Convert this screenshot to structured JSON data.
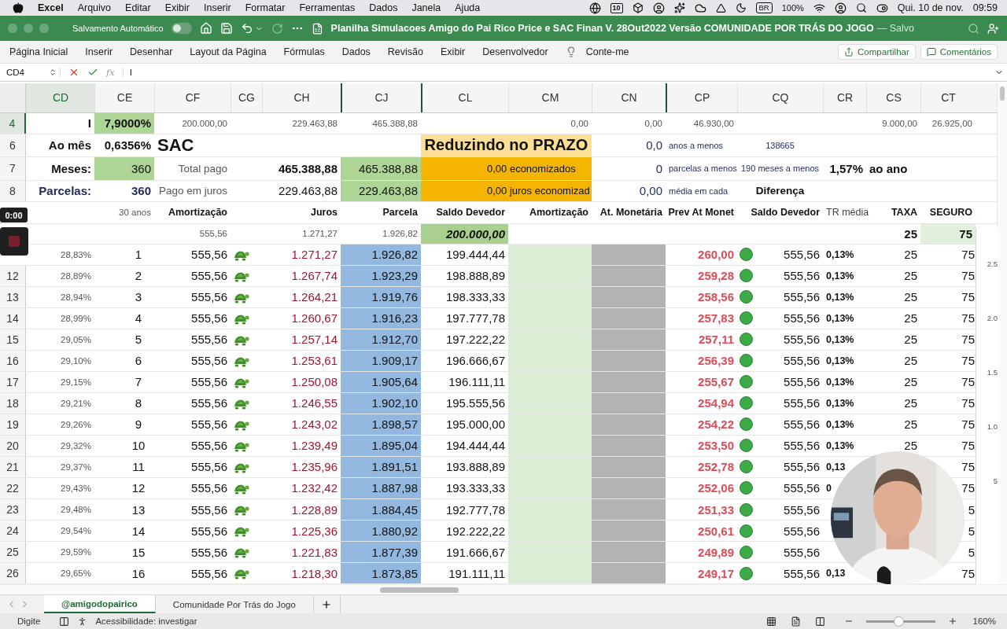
{
  "menu_bar": {
    "app": "Excel",
    "menus": [
      "Arquivo",
      "Editar",
      "Exibir",
      "Inserir",
      "Formatar",
      "Ferramentas",
      "Dados",
      "Janela",
      "Ajuda"
    ],
    "calendar_day": "10",
    "keyboard": "BR",
    "battery": "100%",
    "date": "Qui. 10 de nov.",
    "time": "09:59"
  },
  "title_bar": {
    "autosave_label": "Salvamento Automático",
    "autosave_on": false,
    "title": "Planilha Simulacoes Amigo do Pai Rico Price e SAC Finan V. 28Out2022 Versão COMUNIDADE POR TRÁS DO JOGO",
    "status": "— Salvo"
  },
  "ribbon": {
    "tabs": [
      "Página Inicial",
      "Inserir",
      "Desenhar",
      "Layout da Página",
      "Fórmulas",
      "Dados",
      "Revisão",
      "Exibir",
      "Desenvolvedor"
    ],
    "tell_me": "Conte-me",
    "share": "Compartilhar",
    "comments": "Comentários"
  },
  "formula_bar": {
    "cell": "CD4",
    "function_label": "fx",
    "value": "I"
  },
  "sheet": {
    "columns": [
      {
        "label": "CD",
        "selected": true
      },
      {
        "label": "CE",
        "selected": false
      },
      {
        "label": "CF",
        "selected": false
      },
      {
        "label": "CG",
        "selected": false
      },
      {
        "label": "CH",
        "selected": false
      },
      {
        "label": "CJ",
        "selected": false
      },
      {
        "label": "CL",
        "selected": false
      },
      {
        "label": "CM",
        "selected": false
      },
      {
        "label": "CN",
        "selected": false
      },
      {
        "label": "CP",
        "selected": false
      },
      {
        "label": "CQ",
        "selected": false
      },
      {
        "label": "CR",
        "selected": false
      },
      {
        "label": "CS",
        "selected": false
      },
      {
        "label": "CT",
        "selected": false
      }
    ],
    "top_rows": [
      {
        "number": "4",
        "selected": true,
        "cells": [
          {
            "kind": "label",
            "text": "I"
          },
          {
            "kind": "input-bold",
            "text": "7,9000%"
          },
          {
            "kind": "small",
            "text": "200.000,00"
          },
          {
            "kind": "empty"
          },
          {
            "kind": "small",
            "text": "229.463,88"
          },
          {
            "kind": "small",
            "text": "465.388,88"
          },
          {
            "kind": "empty"
          },
          {
            "kind": "small",
            "text": "0,00"
          },
          {
            "kind": "small",
            "text": "0,00"
          },
          {
            "kind": "small",
            "text": "46.930,00"
          },
          {
            "kind": "empty"
          },
          {
            "kind": "empty"
          },
          {
            "kind": "small",
            "text": "9.000,00"
          },
          {
            "kind": "small",
            "text": "26.925,00"
          }
        ]
      },
      {
        "number": "6",
        "selected": false,
        "cells": [
          {
            "kind": "label",
            "text": "Ao mês"
          },
          {
            "kind": "strong",
            "text": "0,6356%"
          },
          {
            "kind": "title",
            "text": "SAC"
          },
          {
            "kind": "empty"
          },
          {
            "kind": "empty"
          },
          {
            "kind": "banner",
            "text": "Reduzindo no PRAZO"
          },
          {
            "kind": "navy-number",
            "text": "0,0"
          },
          {
            "kind": "navy-small",
            "text": "anos a menos"
          },
          {
            "kind": "navy-small-center",
            "text": "138665"
          },
          {
            "kind": "empty"
          },
          {
            "kind": "empty"
          },
          {
            "kind": "empty"
          }
        ]
      },
      {
        "number": "7",
        "selected": false,
        "cells": [
          {
            "kind": "label",
            "text": "Meses:"
          },
          {
            "kind": "input",
            "text": "360"
          },
          {
            "kind": "caption",
            "text": "Total pago"
          },
          {
            "kind": "empty"
          },
          {
            "kind": "strong",
            "text": "465.388,88"
          },
          {
            "kind": "green-number",
            "text": "465.388,88"
          },
          {
            "kind": "orange",
            "text": "0,00 economizados"
          },
          {
            "kind": "navy-number",
            "text": "0"
          },
          {
            "kind": "navy-small",
            "text": "parcelas a menos"
          },
          {
            "kind": "navy-small-center",
            "text": "190 meses a menos"
          },
          {
            "kind": "strong",
            "text": "1,57%"
          },
          {
            "kind": "strong-left",
            "text": "ao ano"
          },
          {
            "kind": "empty"
          }
        ]
      },
      {
        "number": "8",
        "selected": false,
        "cells": [
          {
            "kind": "label-navy",
            "text": "Parcelas:"
          },
          {
            "kind": "value-navy",
            "text": "360"
          },
          {
            "kind": "caption",
            "text": "Pago em juros"
          },
          {
            "kind": "empty"
          },
          {
            "kind": "number",
            "text": "229.463,88"
          },
          {
            "kind": "green-number",
            "text": "229.463,88"
          },
          {
            "kind": "orange",
            "text": "0,00 juros economizad"
          },
          {
            "kind": "navy-number",
            "text": "0,00"
          },
          {
            "kind": "navy-small",
            "text": "média em cada"
          },
          {
            "kind": "strong-center",
            "text": "Diferença"
          },
          {
            "kind": "empty"
          },
          {
            "kind": "empty"
          },
          {
            "kind": "empty"
          }
        ]
      },
      {
        "selected": false,
        "cells": [
          {
            "kind": "empty"
          },
          {
            "kind": "small",
            "text": "30 anos"
          },
          {
            "kind": "header",
            "text": "Amortização"
          },
          {
            "kind": "empty"
          },
          {
            "kind": "header",
            "text": "Juros"
          },
          {
            "kind": "header",
            "text": "Parcela"
          },
          {
            "kind": "header",
            "text": "Saldo Devedor"
          },
          {
            "kind": "header",
            "text": "Amortização"
          },
          {
            "kind": "header",
            "text": "At. Monetária"
          },
          {
            "kind": "header",
            "text": "Prev At Monet"
          },
          {
            "kind": "header",
            "text": "Saldo Devedor"
          },
          {
            "kind": "header-plain",
            "text": "TR média"
          },
          {
            "kind": "header",
            "text": "TAXA"
          },
          {
            "kind": "header",
            "text": "SEGURO"
          }
        ]
      },
      {
        "selected": false,
        "cells": [
          {
            "kind": "empty"
          },
          {
            "kind": "empty"
          },
          {
            "kind": "small",
            "text": "555,56"
          },
          {
            "kind": "empty"
          },
          {
            "kind": "small",
            "text": "1.271,27"
          },
          {
            "kind": "small",
            "text": "1.926,82"
          },
          {
            "kind": "initial",
            "text": "200.000,00"
          },
          {
            "kind": "empty"
          },
          {
            "kind": "empty"
          },
          {
            "kind": "empty"
          },
          {
            "kind": "empty"
          },
          {
            "kind": "empty"
          },
          {
            "kind": "strong",
            "text": "25"
          },
          {
            "kind": "strong-tint",
            "text": "75"
          }
        ]
      }
    ],
    "data_rows": [
      {
        "pct": "28,83%",
        "n": "1",
        "amort": "555,56",
        "juros": "1.271,27",
        "parcela": "1.926,82",
        "saldo": "199.444,44",
        "prev": "260,00",
        "color": "#3daa48",
        "saldo2": "555,56",
        "tr": "0,13%",
        "taxa": "25",
        "seguro": "75"
      },
      {
        "number": "12",
        "pct": "28,89%",
        "n": "2",
        "amort": "555,56",
        "juros": "1.267,74",
        "parcela": "1.923,29",
        "saldo": "198.888,89",
        "prev": "259,28",
        "color": "#3daa48",
        "saldo2": "555,56",
        "tr": "0,13%",
        "taxa": "25",
        "seguro": "75"
      },
      {
        "number": "13",
        "pct": "28,94%",
        "n": "3",
        "amort": "555,56",
        "juros": "1.264,21",
        "parcela": "1.919,76",
        "saldo": "198.333,33",
        "prev": "258,56",
        "color": "#3daa48",
        "saldo2": "555,56",
        "tr": "0,13%",
        "taxa": "25",
        "seguro": "75"
      },
      {
        "number": "14",
        "pct": "28,99%",
        "n": "4",
        "amort": "555,56",
        "juros": "1.260,67",
        "parcela": "1.916,23",
        "saldo": "197.777,78",
        "prev": "257,83",
        "color": "#3daa48",
        "saldo2": "555,56",
        "tr": "0,13%",
        "taxa": "25",
        "seguro": "75"
      },
      {
        "number": "15",
        "pct": "29,05%",
        "n": "5",
        "amort": "555,56",
        "juros": "1.257,14",
        "parcela": "1.912,70",
        "saldo": "197.222,22",
        "prev": "257,11",
        "color": "#3daa48",
        "saldo2": "555,56",
        "tr": "0,13%",
        "taxa": "25",
        "seguro": "75"
      },
      {
        "number": "16",
        "pct": "29,10%",
        "n": "6",
        "amort": "555,56",
        "juros": "1.253,61",
        "parcela": "1.909,17",
        "saldo": "196.666,67",
        "prev": "256,39",
        "color": "#3daa48",
        "saldo2": "555,56",
        "tr": "0,13%",
        "taxa": "25",
        "seguro": "75"
      },
      {
        "number": "17",
        "pct": "29,15%",
        "n": "7",
        "amort": "555,56",
        "juros": "1.250,08",
        "parcela": "1.905,64",
        "saldo": "196.111,11",
        "prev": "255,67",
        "color": "#3daa48",
        "saldo2": "555,56",
        "tr": "0,13%",
        "taxa": "25",
        "seguro": "75"
      },
      {
        "number": "18",
        "pct": "29,21%",
        "n": "8",
        "amort": "555,56",
        "juros": "1.246,55",
        "parcela": "1.902,10",
        "saldo": "195.555,56",
        "prev": "254,94",
        "color": "#3daa48",
        "saldo2": "555,56",
        "tr": "0,13%",
        "taxa": "25",
        "seguro": "75"
      },
      {
        "number": "19",
        "pct": "29,26%",
        "n": "9",
        "amort": "555,56",
        "juros": "1.243,02",
        "parcela": "1.898,57",
        "saldo": "195.000,00",
        "prev": "254,22",
        "color": "#3daa48",
        "saldo2": "555,56",
        "tr": "0,13%",
        "taxa": "25",
        "seguro": "75"
      },
      {
        "number": "20",
        "pct": "29,32%",
        "n": "10",
        "amort": "555,56",
        "juros": "1.239,49",
        "parcela": "1.895,04",
        "saldo": "194.444,44",
        "prev": "253,50",
        "color": "#3daa48",
        "saldo2": "555,56",
        "tr": "0,13%",
        "taxa": "25",
        "seguro": "75"
      },
      {
        "number": "21",
        "pct": "29,37%",
        "n": "11",
        "amort": "555,56",
        "juros": "1.235,96",
        "parcela": "1.891,51",
        "saldo": "193.888,89",
        "prev": "252,78",
        "color": "#3daa48",
        "saldo2": "555,56",
        "tr": "0,13",
        "seguro": "75"
      },
      {
        "number": "22",
        "pct": "29,43%",
        "n": "12",
        "amort": "555,56",
        "juros": "1.232,42",
        "parcela": "1.887,98",
        "saldo": "193.333,33",
        "prev": "252,06",
        "color": "#3daa48",
        "saldo2": "555,56",
        "tr": "0",
        "seguro": "75"
      },
      {
        "number": "23",
        "pct": "29,48%",
        "n": "13",
        "amort": "555,56",
        "juros": "1.228,89",
        "parcela": "1.884,45",
        "saldo": "192.777,78",
        "prev": "251,33",
        "color": "#3daa48",
        "saldo2": "555,56",
        "seguro": "5"
      },
      {
        "number": "24",
        "pct": "29,54%",
        "n": "14",
        "amort": "555,56",
        "juros": "1.225,36",
        "parcela": "1.880,92",
        "saldo": "192.222,22",
        "prev": "250,61",
        "color": "#3daa48",
        "saldo2": "555,56",
        "seguro": "5"
      },
      {
        "number": "25",
        "pct": "29,59%",
        "n": "15",
        "amort": "555,56",
        "juros": "1.221,83",
        "parcela": "1.877,39",
        "saldo": "191.666,67",
        "prev": "249,89",
        "color": "#3daa48",
        "saldo2": "555,56",
        "seguro": "5"
      },
      {
        "number": "26",
        "pct": "29,65%",
        "n": "16",
        "amort": "555,56",
        "juros": "1.218,30",
        "parcela": "1.873,85",
        "saldo": "191.111,11",
        "prev": "249,17",
        "color": "#3daa48",
        "saldo2": "555,56",
        "tr": "0,13",
        "seguro": "75"
      }
    ]
  },
  "chart_edge": {
    "labels": [
      "2.5",
      "2.0",
      "1.5",
      "1.0",
      "5"
    ]
  },
  "video": {
    "time": "0:00"
  },
  "sheet_tabs": [
    {
      "label": "@amigodopairico",
      "selected": true
    },
    {
      "label": "Comunidade Por Trás do Jogo",
      "selected": false
    }
  ],
  "status_bar": {
    "mode": "Digite",
    "accessibility": "Acessibilidade: investigar",
    "zoom": {
      "level": 0.47
    },
    "zoom_label": "160%"
  }
}
